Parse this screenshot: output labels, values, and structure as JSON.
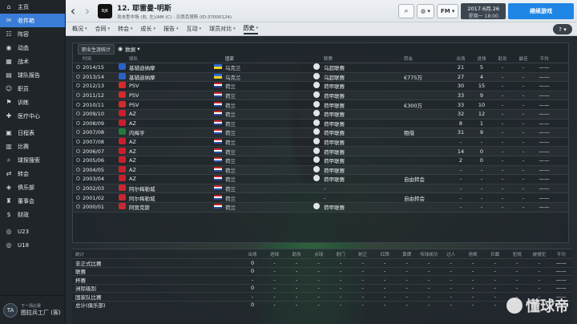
{
  "sidebar": {
    "items": [
      {
        "label": "主页",
        "icon": "home-icon",
        "glyph": "⌂"
      },
      {
        "label": "收件箱",
        "icon": "inbox-icon",
        "glyph": "✉",
        "active": true
      },
      {
        "label": "阵容",
        "icon": "squad-icon",
        "glyph": "☷"
      },
      {
        "label": "动态",
        "icon": "dynamics-icon",
        "glyph": "◉"
      },
      {
        "label": "战术",
        "icon": "tactics-icon",
        "glyph": "▦"
      },
      {
        "label": "球队报告",
        "icon": "report-icon",
        "glyph": "▤"
      },
      {
        "label": "职员",
        "icon": "staff-icon",
        "glyph": "☺"
      },
      {
        "label": "训练",
        "icon": "training-icon",
        "glyph": "⚑"
      },
      {
        "label": "医疗中心",
        "icon": "medical-icon",
        "glyph": "✚"
      },
      {
        "sep": true
      },
      {
        "label": "日程表",
        "icon": "calendar-icon",
        "glyph": "▣"
      },
      {
        "label": "比赛",
        "icon": "match-icon",
        "glyph": "▥"
      },
      {
        "label": "球探搜索",
        "icon": "scouting-icon",
        "glyph": "⌕"
      },
      {
        "label": "转会",
        "icon": "transfer-icon",
        "glyph": "⇄"
      },
      {
        "label": "俱乐部",
        "icon": "club-icon",
        "glyph": "◈"
      },
      {
        "label": "董事会",
        "icon": "board-icon",
        "glyph": "♜"
      },
      {
        "label": "财政",
        "icon": "finance-icon",
        "glyph": "$"
      },
      {
        "sep": true
      },
      {
        "label": "U23",
        "icon": "u23-icon",
        "glyph": "◎"
      },
      {
        "label": "U18",
        "icon": "u18-icon",
        "glyph": "◎"
      }
    ],
    "bottom": {
      "small": "下一场比赛",
      "big": "图拉兵工厂 (客)",
      "badge": "TA"
    }
  },
  "header": {
    "number_name": "12. 耶雷曼-明斯",
    "subtitle": "攻击型中场 (右, 左)/AM (C) - 贝西克塔斯 (ID:37000124)",
    "date_line1": "2017.6月.26",
    "date_line2": "星期一 18:00",
    "continue_label": "继续游戏",
    "fm_label": "FM"
  },
  "tabs": [
    {
      "label": "概况",
      "caret": true
    },
    {
      "label": "合同",
      "caret": true
    },
    {
      "label": "转会",
      "caret": true
    },
    {
      "label": "成长",
      "caret": true
    },
    {
      "label": "报告",
      "caret": true
    },
    {
      "label": "互动",
      "caret": true
    },
    {
      "label": "球员对比",
      "caret": true
    },
    {
      "label": "历史",
      "caret": true,
      "active": true
    }
  ],
  "history": {
    "toolbar": {
      "career_btn": "职业生涯统计",
      "data_btn": "数据"
    },
    "columns": [
      "时间",
      "球队",
      "国家",
      "联赛",
      "转会",
      "出场",
      "进球",
      "助攻",
      "最佳",
      "平均"
    ],
    "rows": [
      {
        "time": "2014/15",
        "club": "基辅迪纳摩",
        "crest_color": "#2a62c9",
        "flag": "ukr",
        "country": "乌克兰",
        "league": "乌超联赛",
        "fee": "",
        "apps": "21",
        "goals": "5",
        "assists": "-",
        "pom": "-",
        "avg": "——"
      },
      {
        "time": "2013/14",
        "club": "基辅迪纳摩",
        "crest_color": "#2a62c9",
        "flag": "ukr",
        "country": "乌克兰",
        "league": "乌超联赛",
        "fee": "€775万",
        "apps": "27",
        "goals": "4",
        "assists": "-",
        "pom": "-",
        "avg": "——"
      },
      {
        "time": "2012/13",
        "club": "PSV",
        "crest_color": "#d22b2b",
        "flag": "ned",
        "country": "荷兰",
        "league": "荷甲联赛",
        "fee": "",
        "apps": "30",
        "goals": "15",
        "assists": "-",
        "pom": "-",
        "avg": "——"
      },
      {
        "time": "2011/12",
        "club": "PSV",
        "crest_color": "#d22b2b",
        "flag": "ned",
        "country": "荷兰",
        "league": "荷甲联赛",
        "fee": "",
        "apps": "33",
        "goals": "9",
        "assists": "-",
        "pom": "-",
        "avg": "——"
      },
      {
        "time": "2010/11",
        "club": "PSV",
        "crest_color": "#d22b2b",
        "flag": "ned",
        "country": "荷兰",
        "league": "荷甲联赛",
        "fee": "€300万",
        "apps": "33",
        "goals": "10",
        "assists": "-",
        "pom": "-",
        "avg": "——"
      },
      {
        "time": "2009/10",
        "club": "AZ",
        "crest_color": "#c81f2c",
        "flag": "ned",
        "country": "荷兰",
        "league": "荷甲联赛",
        "fee": "",
        "apps": "32",
        "goals": "12",
        "assists": "-",
        "pom": "-",
        "avg": "——"
      },
      {
        "time": "2008/09",
        "club": "AZ",
        "crest_color": "#c81f2c",
        "flag": "ned",
        "country": "荷兰",
        "league": "荷甲联赛",
        "fee": "",
        "apps": "8",
        "goals": "1",
        "assists": "-",
        "pom": "-",
        "avg": "——"
      },
      {
        "time": "2007/08",
        "club": "内梅亨",
        "crest_color": "#1f7a3e",
        "flag": "ned",
        "country": "荷兰",
        "league": "荷甲联赛",
        "fee": "租借",
        "apps": "31",
        "goals": "9",
        "assists": "-",
        "pom": "-",
        "avg": "——"
      },
      {
        "time": "2007/08",
        "club": "AZ",
        "crest_color": "#c81f2c",
        "flag": "ned",
        "country": "荷兰",
        "league": "荷甲联赛",
        "fee": "",
        "apps": "-",
        "goals": "-",
        "assists": "-",
        "pom": "-",
        "avg": "——"
      },
      {
        "time": "2006/07",
        "club": "AZ",
        "crest_color": "#c81f2c",
        "flag": "ned",
        "country": "荷兰",
        "league": "荷甲联赛",
        "fee": "",
        "apps": "14",
        "goals": "0",
        "assists": "-",
        "pom": "-",
        "avg": "——"
      },
      {
        "time": "2005/06",
        "club": "AZ",
        "crest_color": "#c81f2c",
        "flag": "ned",
        "country": "荷兰",
        "league": "荷甲联赛",
        "fee": "",
        "apps": "2",
        "goals": "0",
        "assists": "-",
        "pom": "-",
        "avg": "——"
      },
      {
        "time": "2004/05",
        "club": "AZ",
        "crest_color": "#c81f2c",
        "flag": "ned",
        "country": "荷兰",
        "league": "荷甲联赛",
        "fee": "",
        "apps": "-",
        "goals": "-",
        "assists": "-",
        "pom": "-",
        "avg": "——"
      },
      {
        "time": "2003/04",
        "club": "AZ",
        "crest_color": "#c81f2c",
        "flag": "ned",
        "country": "荷兰",
        "league": "荷甲联赛",
        "fee": "自由转会",
        "apps": "-",
        "goals": "-",
        "assists": "-",
        "pom": "-",
        "avg": "——"
      },
      {
        "time": "2002/03",
        "club": "阿尔梅勒城",
        "crest_color": "#c8282f",
        "flag": "ned",
        "country": "荷兰",
        "league": "-",
        "fee": "",
        "apps": "-",
        "goals": "-",
        "assists": "-",
        "pom": "-",
        "avg": "——"
      },
      {
        "time": "2001/02",
        "club": "阿尔梅勒城",
        "crest_color": "#c8282f",
        "flag": "ned",
        "country": "荷兰",
        "league": "-",
        "fee": "自由转会",
        "apps": "-",
        "goals": "-",
        "assists": "-",
        "pom": "-",
        "avg": "——"
      },
      {
        "time": "2000/01",
        "club": "阿贾克斯",
        "crest_color": "#c8282f",
        "flag": "ned",
        "country": "荷兰",
        "league": "荷甲联赛",
        "fee": "",
        "apps": "-",
        "goals": "-",
        "assists": "-",
        "pom": "-",
        "avg": "——"
      }
    ]
  },
  "stats": {
    "columns": [
      "统计",
      "出场",
      "进球",
      "助攻",
      "点球",
      "射门",
      "射正",
      "红牌",
      "黄牌",
      "传球成功",
      "过人",
      "抢断",
      "拦截",
      "犯规",
      "被侵犯",
      "平均"
    ],
    "rows": [
      {
        "label": "非正式比赛",
        "values": [
          "0",
          "-",
          "-",
          "-",
          "-",
          "-",
          "-",
          "-",
          "-",
          "-",
          "-",
          "-",
          "-",
          "-",
          "——"
        ]
      },
      {
        "label": "联赛",
        "values": [
          "0",
          "-",
          "-",
          "-",
          "-",
          "-",
          "-",
          "-",
          "-",
          "-",
          "-",
          "-",
          "-",
          "-",
          "——"
        ]
      },
      {
        "label": "杯赛",
        "values": [
          "-",
          "-",
          "-",
          "-",
          "-",
          "-",
          "-",
          "-",
          "-",
          "-",
          "-",
          "-",
          "-",
          "-",
          "——"
        ]
      },
      {
        "label": "洲际级别",
        "values": [
          "0",
          "-",
          "-",
          "-",
          "-",
          "-",
          "-",
          "-",
          "-",
          "-",
          "-",
          "-",
          "-",
          "-",
          "——"
        ]
      },
      {
        "label": "国家队比赛",
        "values": [
          "-",
          "-",
          "-",
          "-",
          "-",
          "-",
          "-",
          "-",
          "-",
          "-",
          "-",
          "-",
          "-",
          "-",
          "——"
        ]
      },
      {
        "label": "总计(俱乐部)",
        "values": [
          "0",
          "-",
          "-",
          "-",
          "-",
          "-",
          "-",
          "-",
          "-",
          "-",
          "-",
          "-",
          "-",
          "-",
          "——"
        ]
      }
    ]
  },
  "watermark": "懂球帝"
}
